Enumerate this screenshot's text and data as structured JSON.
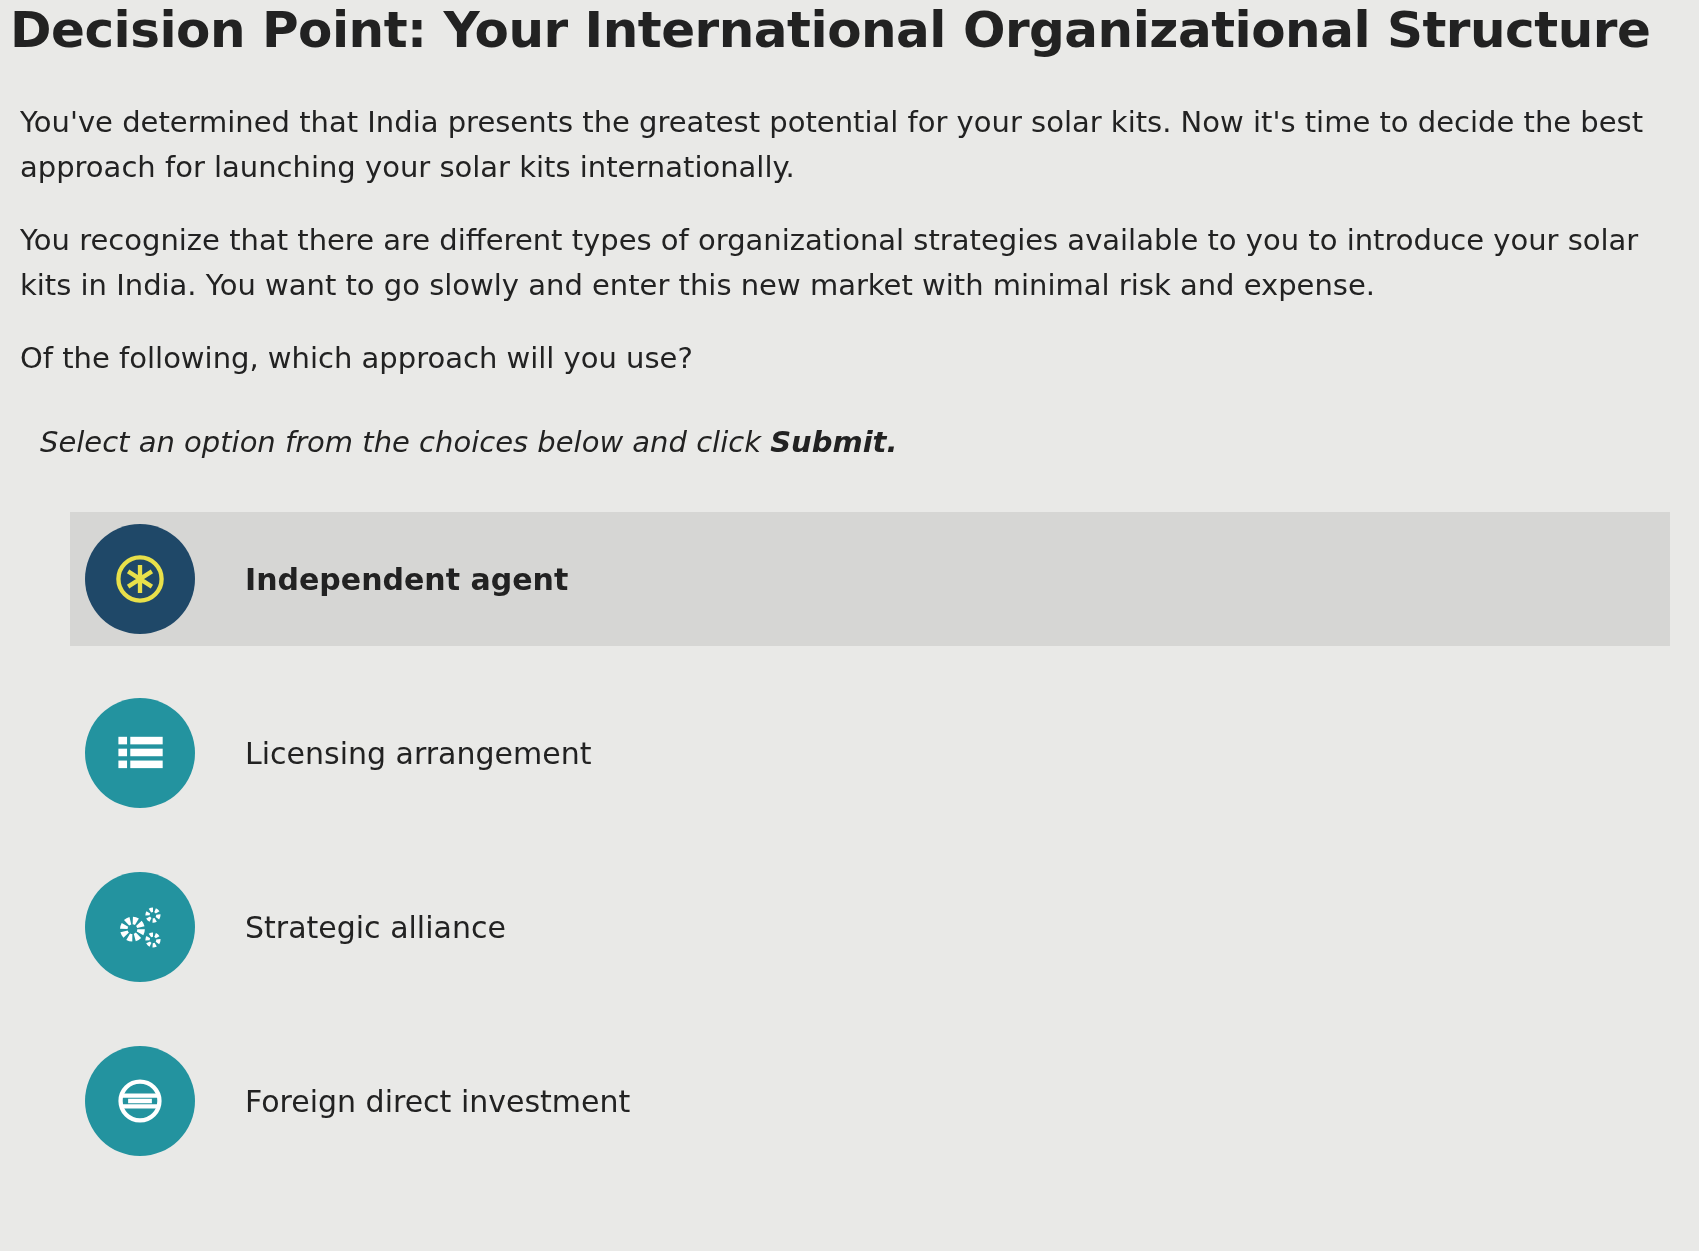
{
  "title": "Decision Point: Your International Organizational Structure",
  "paragraphs": [
    "You've determined that India presents the greatest potential for your solar kits. Now it's time to decide the best approach for launching your solar kits internationally.",
    "You recognize that there are different types of organizational strategies available to you to introduce your solar kits in India. You want to go slowly and enter this new market with minimal risk and expense.",
    "Of the following, which approach will you use?"
  ],
  "instruction": "Select an option from the choices below and click **Submit.**",
  "options": [
    {
      "label": "Independent agent",
      "selected": true
    },
    {
      "label": "Licensing arrangement",
      "selected": false
    },
    {
      "label": "Strategic alliance",
      "selected": false
    },
    {
      "label": "Foreign direct investment",
      "selected": false
    }
  ]
}
